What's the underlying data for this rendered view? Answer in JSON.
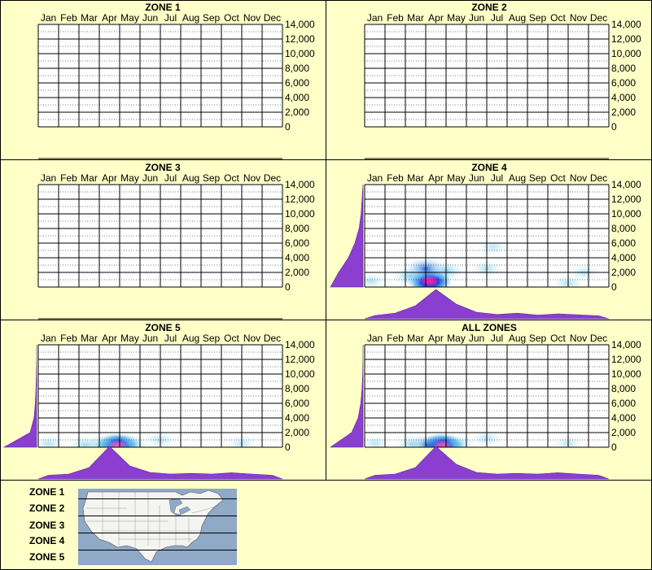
{
  "months": [
    "Jan",
    "Feb",
    "Mar",
    "Apr",
    "May",
    "Jun",
    "Jul",
    "Aug",
    "Sep",
    "Oct",
    "Nov",
    "Dec"
  ],
  "yticks": [
    "14,000",
    "12,000",
    "10,000",
    "8,000",
    "6,000",
    "4,000",
    "2,000",
    "0"
  ],
  "colors": {
    "background": "#ffffc8",
    "density": "#8a3fd1",
    "hot": "#ff2aa0",
    "cool": "#1a4de0",
    "light": "#b9eff5"
  },
  "chart_data": [
    {
      "type": "heatmap",
      "title": "ZONE 1",
      "x": [
        "Jan",
        "Feb",
        "Mar",
        "Apr",
        "May",
        "Jun",
        "Jul",
        "Aug",
        "Sep",
        "Oct",
        "Nov",
        "Dec"
      ],
      "ylim": [
        0,
        14000
      ],
      "has_data": false,
      "hotspots": [],
      "month_density": [],
      "elev_density": []
    },
    {
      "type": "heatmap",
      "title": "ZONE 2",
      "x": [
        "Jan",
        "Feb",
        "Mar",
        "Apr",
        "May",
        "Jun",
        "Jul",
        "Aug",
        "Sep",
        "Oct",
        "Nov",
        "Dec"
      ],
      "ylim": [
        0,
        14000
      ],
      "has_data": false,
      "hotspots": [],
      "month_density": [],
      "elev_density": []
    },
    {
      "type": "heatmap",
      "title": "ZONE 3",
      "x": [
        "Jan",
        "Feb",
        "Mar",
        "Apr",
        "May",
        "Jun",
        "Jul",
        "Aug",
        "Sep",
        "Oct",
        "Nov",
        "Dec"
      ],
      "ylim": [
        0,
        14000
      ],
      "has_data": false,
      "hotspots": [],
      "month_density": [],
      "elev_density": []
    },
    {
      "type": "heatmap",
      "title": "ZONE 4",
      "x": [
        "Jan",
        "Feb",
        "Mar",
        "Apr",
        "May",
        "Jun",
        "Jul",
        "Aug",
        "Sep",
        "Oct",
        "Nov",
        "Dec"
      ],
      "ylim": [
        0,
        14000
      ],
      "has_data": true,
      "hotspots": [
        {
          "month": 3.2,
          "elev": 800,
          "intensity": 1.0
        },
        {
          "month": 3.0,
          "elev": 2500,
          "intensity": 0.55
        },
        {
          "month": 2.2,
          "elev": 1500,
          "intensity": 0.3
        },
        {
          "month": 4.0,
          "elev": 2200,
          "intensity": 0.3
        },
        {
          "month": 6.0,
          "elev": 2500,
          "intensity": 0.12
        },
        {
          "month": 10.0,
          "elev": 500,
          "intensity": 0.12
        },
        {
          "month": 10.8,
          "elev": 2000,
          "intensity": 0.08
        },
        {
          "month": 0.3,
          "elev": 800,
          "intensity": 0.1
        },
        {
          "month": 6.3,
          "elev": 5500,
          "intensity": 0.06
        }
      ],
      "month_density": [
        0.05,
        0.12,
        0.35,
        0.85,
        0.4,
        0.15,
        0.08,
        0.12,
        0.06,
        0.1,
        0.07,
        0.04
      ],
      "elev_density": [
        1.0,
        0.75,
        0.45,
        0.25,
        0.12,
        0.06,
        0.03,
        0.0
      ]
    },
    {
      "type": "heatmap",
      "title": "ZONE 5",
      "x": [
        "Jan",
        "Feb",
        "Mar",
        "Apr",
        "May",
        "Jun",
        "Jul",
        "Aug",
        "Sep",
        "Oct",
        "Nov",
        "Dec"
      ],
      "ylim": [
        0,
        14000
      ],
      "has_data": true,
      "hotspots": [
        {
          "month": 3.9,
          "elev": 200,
          "intensity": 1.0
        },
        {
          "month": 3.2,
          "elev": 300,
          "intensity": 0.4
        },
        {
          "month": 4.6,
          "elev": 400,
          "intensity": 0.3
        },
        {
          "month": 2.3,
          "elev": 300,
          "intensity": 0.2
        },
        {
          "month": 6.0,
          "elev": 1000,
          "intensity": 0.1
        },
        {
          "month": 10.0,
          "elev": 500,
          "intensity": 0.08
        },
        {
          "month": 0.5,
          "elev": 500,
          "intensity": 0.08
        }
      ],
      "month_density": [
        0.06,
        0.1,
        0.3,
        0.95,
        0.35,
        0.15,
        0.1,
        0.12,
        0.1,
        0.14,
        0.1,
        0.06
      ],
      "elev_density": [
        1.0,
        0.2,
        0.08,
        0.04,
        0.02,
        0.01,
        0.0,
        0.0
      ]
    },
    {
      "type": "heatmap",
      "title": "ALL ZONES",
      "x": [
        "Jan",
        "Feb",
        "Mar",
        "Apr",
        "May",
        "Jun",
        "Jul",
        "Aug",
        "Sep",
        "Oct",
        "Nov",
        "Dec"
      ],
      "ylim": [
        0,
        14000
      ],
      "has_data": true,
      "hotspots": [
        {
          "month": 3.8,
          "elev": 200,
          "intensity": 1.0
        },
        {
          "month": 3.1,
          "elev": 300,
          "intensity": 0.45
        },
        {
          "month": 4.6,
          "elev": 400,
          "intensity": 0.3
        },
        {
          "month": 2.3,
          "elev": 400,
          "intensity": 0.2
        },
        {
          "month": 6.0,
          "elev": 1200,
          "intensity": 0.1
        },
        {
          "month": 10.0,
          "elev": 500,
          "intensity": 0.08
        },
        {
          "month": 0.5,
          "elev": 500,
          "intensity": 0.08
        }
      ],
      "month_density": [
        0.06,
        0.1,
        0.3,
        0.95,
        0.4,
        0.15,
        0.1,
        0.12,
        0.1,
        0.14,
        0.1,
        0.06
      ],
      "elev_density": [
        1.0,
        0.35,
        0.15,
        0.07,
        0.03,
        0.01,
        0.0,
        0.0
      ]
    }
  ],
  "legend": {
    "zones": [
      "ZONE 1",
      "ZONE 2",
      "ZONE 3",
      "ZONE 4",
      "ZONE 5"
    ]
  }
}
